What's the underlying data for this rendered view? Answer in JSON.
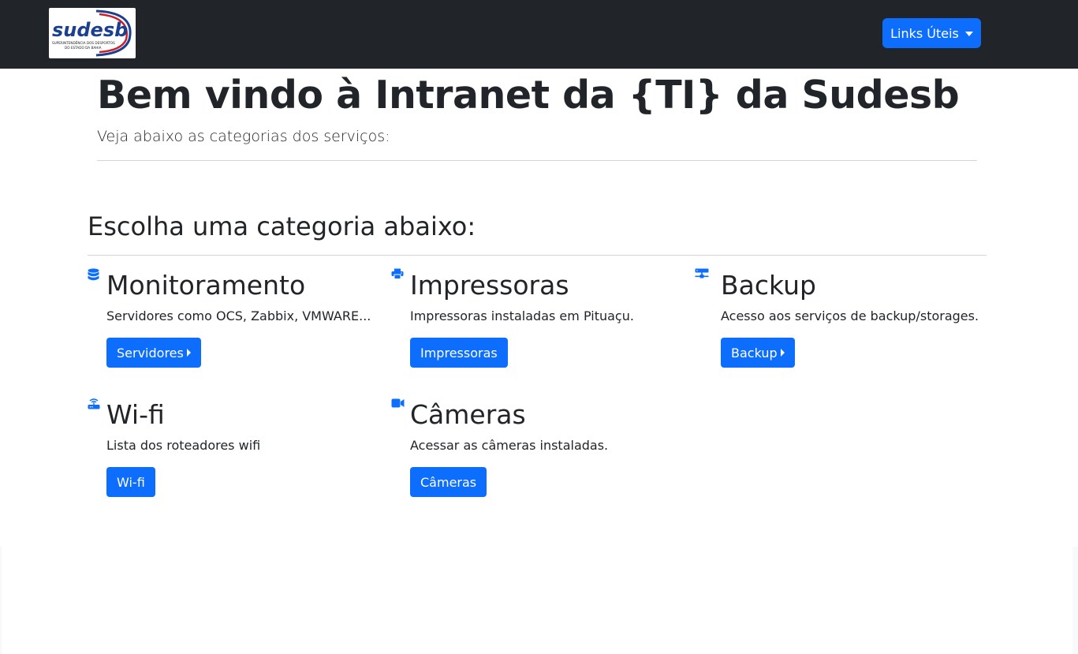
{
  "navbar": {
    "logo_text": "sudesb",
    "logo_subtext": "SUPERINTENDÊNCIA DOS DESPORTOS DO ESTADO DA BAHIA",
    "links_button_label": "Links Úteis"
  },
  "hero": {
    "title": "Bem vindo à Intranet da {TI} da Sudesb",
    "subtitle": "Veja abaixo as categorias dos serviços:"
  },
  "section": {
    "title": "Escolha uma categoria abaixo:"
  },
  "categories": [
    {
      "icon": "database-icon",
      "title": "Monitoramento",
      "description": "Servidores como OCS, Zabbix, VMWARE...",
      "button_label": "Servidores",
      "button_caret": true
    },
    {
      "icon": "printer-icon",
      "title": "Impressoras",
      "description": "Impressoras instaladas em Pituaçu.",
      "button_label": "Impressoras",
      "button_caret": false
    },
    {
      "icon": "network-icon",
      "title": "Backup",
      "description": "Acesso aos serviços de backup/storages.",
      "button_label": "Backup",
      "button_caret": true
    },
    {
      "icon": "router-icon",
      "title": "Wi-fi",
      "description": "Lista dos roteadores wifi",
      "button_label": "Wi-fi",
      "button_caret": false
    },
    {
      "icon": "video-camera-icon",
      "title": "Câmeras",
      "description": "Acessar as câmeras instaladas.",
      "button_label": "Câmeras",
      "button_caret": false
    }
  ],
  "colors": {
    "navbar_bg": "#212529",
    "primary": "#0d6efd",
    "text": "#212529",
    "page_bg": "#f8f9fa"
  }
}
